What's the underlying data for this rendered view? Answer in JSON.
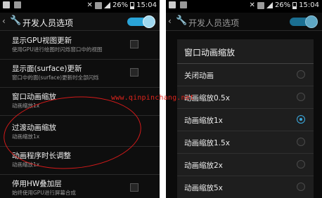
{
  "status_left": {
    "battery": "26%",
    "time": "15:04"
  },
  "status_right": {
    "battery": "26%",
    "time": "15:04"
  },
  "left_screen": {
    "title": "开发人员选项",
    "items": [
      {
        "title": "显示GPU视图更新",
        "subtitle": "使用GPU进行绘图时闪烁窗口中的视图"
      },
      {
        "title": "显示面(surface)更新",
        "subtitle": "窗口中的面(surface)更新时全部闪烁"
      },
      {
        "title": "窗口动画缩放",
        "subtitle": "动画缩放1x"
      },
      {
        "title": "过渡动画缩放",
        "subtitle": "动画缩放1x"
      },
      {
        "title": "动画程序时长调整",
        "subtitle": "动画缩放1x"
      },
      {
        "title": "停用HW叠加层",
        "subtitle": "始终使用GPU进行屏幕合成"
      }
    ]
  },
  "right_screen": {
    "title": "开发人员选项",
    "dialog_title": "窗口动画缩放",
    "options": [
      "关闭动画",
      "动画缩放0.5x",
      "动画缩放1x",
      "动画缩放1.5x",
      "动画缩放2x",
      "动画缩放5x"
    ],
    "selected_index": 2
  },
  "watermark": "www.qinpinchang.net",
  "colors": {
    "accent": "#2aa4d8",
    "annotation": "#d41a1a"
  }
}
